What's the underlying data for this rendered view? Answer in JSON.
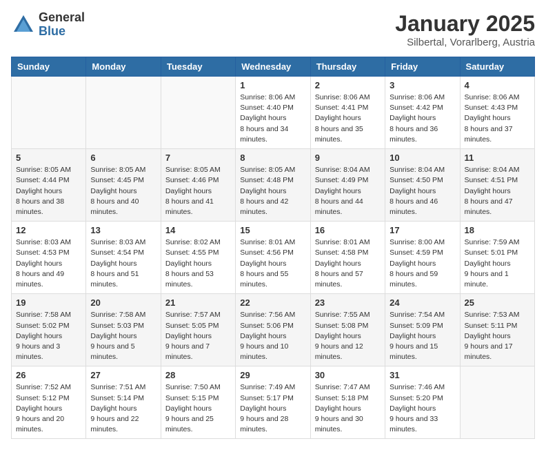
{
  "logo": {
    "general": "General",
    "blue": "Blue"
  },
  "header": {
    "month": "January 2025",
    "location": "Silbertal, Vorarlberg, Austria"
  },
  "days_of_week": [
    "Sunday",
    "Monday",
    "Tuesday",
    "Wednesday",
    "Thursday",
    "Friday",
    "Saturday"
  ],
  "weeks": [
    [
      null,
      null,
      null,
      {
        "day": 1,
        "sunrise": "8:06 AM",
        "sunset": "4:40 PM",
        "daylight": "8 hours and 34 minutes."
      },
      {
        "day": 2,
        "sunrise": "8:06 AM",
        "sunset": "4:41 PM",
        "daylight": "8 hours and 35 minutes."
      },
      {
        "day": 3,
        "sunrise": "8:06 AM",
        "sunset": "4:42 PM",
        "daylight": "8 hours and 36 minutes."
      },
      {
        "day": 4,
        "sunrise": "8:06 AM",
        "sunset": "4:43 PM",
        "daylight": "8 hours and 37 minutes."
      }
    ],
    [
      {
        "day": 5,
        "sunrise": "8:05 AM",
        "sunset": "4:44 PM",
        "daylight": "8 hours and 38 minutes."
      },
      {
        "day": 6,
        "sunrise": "8:05 AM",
        "sunset": "4:45 PM",
        "daylight": "8 hours and 40 minutes."
      },
      {
        "day": 7,
        "sunrise": "8:05 AM",
        "sunset": "4:46 PM",
        "daylight": "8 hours and 41 minutes."
      },
      {
        "day": 8,
        "sunrise": "8:05 AM",
        "sunset": "4:48 PM",
        "daylight": "8 hours and 42 minutes."
      },
      {
        "day": 9,
        "sunrise": "8:04 AM",
        "sunset": "4:49 PM",
        "daylight": "8 hours and 44 minutes."
      },
      {
        "day": 10,
        "sunrise": "8:04 AM",
        "sunset": "4:50 PM",
        "daylight": "8 hours and 46 minutes."
      },
      {
        "day": 11,
        "sunrise": "8:04 AM",
        "sunset": "4:51 PM",
        "daylight": "8 hours and 47 minutes."
      }
    ],
    [
      {
        "day": 12,
        "sunrise": "8:03 AM",
        "sunset": "4:53 PM",
        "daylight": "8 hours and 49 minutes."
      },
      {
        "day": 13,
        "sunrise": "8:03 AM",
        "sunset": "4:54 PM",
        "daylight": "8 hours and 51 minutes."
      },
      {
        "day": 14,
        "sunrise": "8:02 AM",
        "sunset": "4:55 PM",
        "daylight": "8 hours and 53 minutes."
      },
      {
        "day": 15,
        "sunrise": "8:01 AM",
        "sunset": "4:56 PM",
        "daylight": "8 hours and 55 minutes."
      },
      {
        "day": 16,
        "sunrise": "8:01 AM",
        "sunset": "4:58 PM",
        "daylight": "8 hours and 57 minutes."
      },
      {
        "day": 17,
        "sunrise": "8:00 AM",
        "sunset": "4:59 PM",
        "daylight": "8 hours and 59 minutes."
      },
      {
        "day": 18,
        "sunrise": "7:59 AM",
        "sunset": "5:01 PM",
        "daylight": "9 hours and 1 minute."
      }
    ],
    [
      {
        "day": 19,
        "sunrise": "7:58 AM",
        "sunset": "5:02 PM",
        "daylight": "9 hours and 3 minutes."
      },
      {
        "day": 20,
        "sunrise": "7:58 AM",
        "sunset": "5:03 PM",
        "daylight": "9 hours and 5 minutes."
      },
      {
        "day": 21,
        "sunrise": "7:57 AM",
        "sunset": "5:05 PM",
        "daylight": "9 hours and 7 minutes."
      },
      {
        "day": 22,
        "sunrise": "7:56 AM",
        "sunset": "5:06 PM",
        "daylight": "9 hours and 10 minutes."
      },
      {
        "day": 23,
        "sunrise": "7:55 AM",
        "sunset": "5:08 PM",
        "daylight": "9 hours and 12 minutes."
      },
      {
        "day": 24,
        "sunrise": "7:54 AM",
        "sunset": "5:09 PM",
        "daylight": "9 hours and 15 minutes."
      },
      {
        "day": 25,
        "sunrise": "7:53 AM",
        "sunset": "5:11 PM",
        "daylight": "9 hours and 17 minutes."
      }
    ],
    [
      {
        "day": 26,
        "sunrise": "7:52 AM",
        "sunset": "5:12 PM",
        "daylight": "9 hours and 20 minutes."
      },
      {
        "day": 27,
        "sunrise": "7:51 AM",
        "sunset": "5:14 PM",
        "daylight": "9 hours and 22 minutes."
      },
      {
        "day": 28,
        "sunrise": "7:50 AM",
        "sunset": "5:15 PM",
        "daylight": "9 hours and 25 minutes."
      },
      {
        "day": 29,
        "sunrise": "7:49 AM",
        "sunset": "5:17 PM",
        "daylight": "9 hours and 28 minutes."
      },
      {
        "day": 30,
        "sunrise": "7:47 AM",
        "sunset": "5:18 PM",
        "daylight": "9 hours and 30 minutes."
      },
      {
        "day": 31,
        "sunrise": "7:46 AM",
        "sunset": "5:20 PM",
        "daylight": "9 hours and 33 minutes."
      },
      null
    ]
  ],
  "labels": {
    "sunrise": "Sunrise:",
    "sunset": "Sunset:",
    "daylight": "Daylight hours"
  }
}
